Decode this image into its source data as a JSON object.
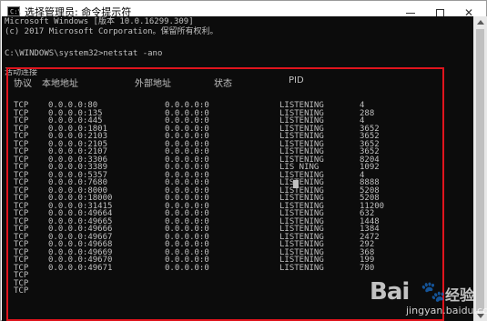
{
  "window": {
    "title": "选择管理员: 命令提示符",
    "icon_label": "C:\\",
    "minimize_icon": "minimize-icon",
    "maximize_icon": "maximize-icon",
    "close_icon": "close-icon"
  },
  "console": {
    "banner_line1": "Microsoft Windows [版本 10.0.16299.309]",
    "banner_line2": "(c) 2017 Microsoft Corporation。保留所有权利。",
    "prompt_line": "C:\\WINDOWS\\system32>netstat -ano",
    "section_title": "活动连接",
    "headers": {
      "proto": "协议",
      "local": "本地地址",
      "foreign": "外部地址",
      "state": "状态",
      "pid": "PID"
    },
    "protos": "TCP\nTCP\nTCP\nTCP\nTCP\nTCP\nTCP\nTCP\nTCP\nTCP\nTCP\nTCP\nTCP\nTCP\nTCP\nTCP\nTCP\nTCP\nTCP\nTCP\nTCP\nTCP\nTCP\nTCP\nTCP",
    "locals": "0.0.0.0:80\n0.0.0.0:135\n0.0.0.0:445\n0.0.0.0:1801\n0.0.0.0:2103\n0.0.0.0:2105\n0.0.0.0:2107\n0.0.0.0:3306\n0.0.0.0:3389\n0.0.0.0:5357\n0.0.0.0:7680\n0.0.0.0:8000\n0.0.0.0:18000\n0.0.0.0:31415\n0.0.0.0:49664\n0.0.0.0:49665\n0.0.0.0:49666\n0.0.0.0:49667\n0.0.0.0:49668\n0.0.0.0:49669\n0.0.0.0:49670\n0.0.0.0:49671",
    "foreigns": "0.0.0.0:0\n0.0.0.0:0\n0.0.0.0:0\n0.0.0.0:0\n0.0.0.0:0\n0.0.0.0:0\n0.0.0.0:0\n0.0.0.0:0\n0.0.0.0:0\n0.0.0.0:0\n0.0.0.0:0\n0.0.0.0:0\n0.0.0.0:0\n0.0.0.0:0\n0.0.0.0:0\n0.0.0.0:0\n0.0.0.0:0\n0.0.0.0:0\n0.0.0.0:0\n0.0.0.0:0\n0.0.0.0:0\n0.0.0.0:0",
    "states": "LISTENING\nLISTENING\nLISTENING\nLISTENING\nLISTENING\nLISTENING\nLISTENING\nLISTENING\nLIS NING\nLISTENING\nLISTENING\nLISTENING\nLISTENING\nLISTENING\nLISTENING\nLISTENING\nLISTENING\nLISTENING\nLISTENING\nLISTENING\nLISTENING\nLISTENING",
    "pids": "4\n288\n4\n3652\n3652\n3652\n3652\n8204\n1092\n4\n8888\n5208\n5208\n11200\n632\n1448\n1384\n2472\n292\n368\n199\n780"
  },
  "watermark": {
    "logo": "Bai",
    "paw": "🐾",
    "brand": "经验",
    "url": "jingyan.baidu.com"
  }
}
